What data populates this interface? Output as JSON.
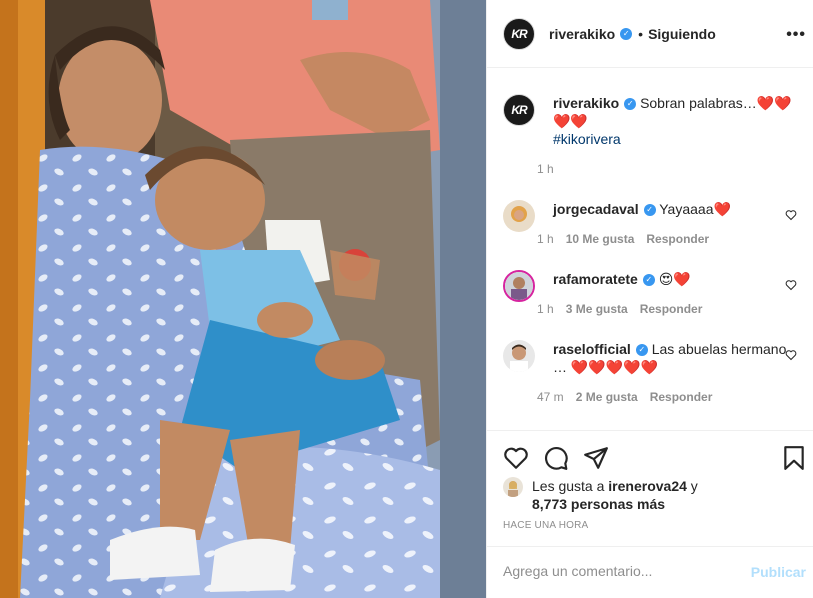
{
  "post": {
    "author": "riverakiko",
    "follow_label": "Siguiendo",
    "dot": "•",
    "more": "•••",
    "avatar_text": "KR",
    "caption_text": "Sobran palabras…",
    "caption_hearts": "❤️❤️❤️❤️",
    "hashtag": "#kikorivera",
    "caption_time": "1 h"
  },
  "comments": [
    {
      "user": "jorgecadaval",
      "text": "Yayaaaa❤️",
      "time": "1 h",
      "likes": "10 Me gusta",
      "reply": "Responder"
    },
    {
      "user": "rafamoratete",
      "text": "😍❤️",
      "time": "1 h",
      "likes": "3 Me gusta",
      "reply": "Responder"
    },
    {
      "user": "raselofficial",
      "text": "Las abuelas hermano … ❤️❤️❤️❤️❤️",
      "time": "47 m",
      "likes": "2 Me gusta",
      "reply": "Responder"
    }
  ],
  "likes": {
    "prefix": "Les gusta a",
    "user": "irenerova24",
    "conj": "y",
    "count": "8,773 personas más"
  },
  "time_ago": "HACE UNA HORA",
  "add_comment": {
    "placeholder": "Agrega un comentario...",
    "post_label": "Publicar"
  },
  "colors": {
    "link": "#00376b",
    "verified": "#3897f0",
    "heart": "#ed1c24",
    "publish_disabled": "#b2dffc"
  },
  "icons": [
    "heart-icon",
    "comment-icon",
    "share-icon",
    "bookmark-icon",
    "verified-icon",
    "more-icon"
  ]
}
